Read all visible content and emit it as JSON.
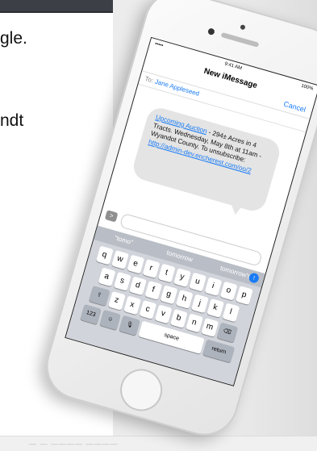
{
  "background": {
    "fragments": [
      "gle.",
      "ndt"
    ]
  },
  "phone": {
    "status": {
      "signal": "•••••",
      "time": "9:41 AM",
      "battery": "100%"
    },
    "nav": {
      "title": "New iMessage",
      "cancel": "Cancel"
    },
    "to": {
      "label": "To:",
      "name": "Jane Appleseed"
    },
    "message": {
      "link_text": "Upcoming Auction",
      "body": " - 294± Acres in 4 Tracts. Wednesday, May 8th at 11am - Wyandot County. To unsubscribe: ",
      "url": "http://admin-dev.encherest.com/oo/2"
    },
    "app_button": ">",
    "predictive": [
      "\"tomo\"",
      "tomorrow",
      "tomorrow's"
    ],
    "send_icon": "↑",
    "keys": {
      "row1": [
        "q",
        "w",
        "e",
        "r",
        "t",
        "y",
        "u",
        "i",
        "o",
        "p"
      ],
      "row2": [
        "a",
        "s",
        "d",
        "f",
        "g",
        "h",
        "j",
        "k",
        "l"
      ],
      "row3": [
        "z",
        "x",
        "c",
        "v",
        "b",
        "n",
        "m"
      ],
      "shift": "⇧",
      "delete": "⌫",
      "num": "123",
      "emoji": "☺",
      "mic": "🎙",
      "space": "space",
      "return": "return"
    }
  },
  "footer": {
    "text": "— — ———— ————"
  }
}
